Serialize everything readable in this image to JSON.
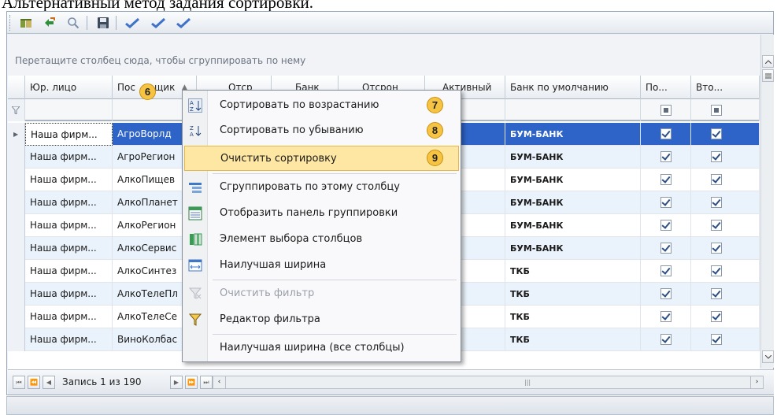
{
  "document": {
    "title": "Альтернативный метод задания сортировки."
  },
  "toolbar": {
    "icons": [
      "layout-icon",
      "refresh-icon",
      "search-icon",
      "save-icon",
      "check-icon",
      "check-all-icon",
      "check-selected-icon"
    ]
  },
  "group_panel": {
    "hint": "Перетащите столбец сюда, чтобы сгруппировать по нему"
  },
  "grid": {
    "columns": [
      "Юр. лицо",
      "Пос",
      "щик",
      "Отср",
      "Банк",
      "Отсрон",
      "Активный",
      "Банк по умолчанию",
      "По...",
      "Вто..."
    ],
    "rows": [
      {
        "legal": "Наша фирм...",
        "supplier": "АгроВорлд",
        "active": true,
        "bank": "БУМ-БАНК",
        "p1": true,
        "p2": true
      },
      {
        "legal": "Наша фирм...",
        "supplier": "АгроРегион",
        "active": true,
        "bank": "БУМ-БАНК",
        "p1": true,
        "p2": true
      },
      {
        "legal": "Наша фирм...",
        "supplier": "АлкоПищев",
        "active": true,
        "bank": "БУМ-БАНК",
        "p1": true,
        "p2": true
      },
      {
        "legal": "Наша фирм...",
        "supplier": "АлкоПланет",
        "active": false,
        "bank": "БУМ-БАНК",
        "p1": true,
        "p2": true
      },
      {
        "legal": "Наша фирм...",
        "supplier": "АлкоРегион",
        "active": true,
        "bank": "БУМ-БАНК",
        "p1": true,
        "p2": true
      },
      {
        "legal": "Наша фирм...",
        "supplier": "АлкоСервис",
        "active": true,
        "bank": "БУМ-БАНК",
        "p1": true,
        "p2": true
      },
      {
        "legal": "Наша фирм...",
        "supplier": "АлкоСинтез",
        "active": false,
        "bank": "ТКБ",
        "p1": true,
        "p2": true
      },
      {
        "legal": "Наша фирм...",
        "supplier": "АлкоТелеПл",
        "active": false,
        "bank": "ТКБ",
        "p1": true,
        "p2": true
      },
      {
        "legal": "Наша фирм...",
        "supplier": "АлкоТелеСе",
        "active": false,
        "bank": "ТКБ",
        "p1": true,
        "p2": true
      },
      {
        "legal": "Наша фирм...",
        "supplier": "ВиноКолбас",
        "active": false,
        "bank": "ТКБ",
        "p1": true,
        "p2": true
      }
    ]
  },
  "pager": {
    "record_text": "Запись 1 из 190"
  },
  "context_menu": {
    "items": [
      {
        "label": "Сортировать по возрастанию",
        "icon": "sort-ascending-icon",
        "badge": "7"
      },
      {
        "label": "Сортировать по убыванию",
        "icon": "sort-descending-icon",
        "badge": "8"
      },
      {
        "label": "Очистить сортировку",
        "icon": "clear-sort-icon",
        "badge": "9"
      },
      {
        "label": "Сгруппировать по этому столбцу",
        "icon": "group-by-icon"
      },
      {
        "label": "Отобразить панель группировки",
        "icon": "group-panel-icon"
      },
      {
        "label": "Элемент выбора столбцов",
        "icon": "column-chooser-icon"
      },
      {
        "label": "Наилучшая ширина",
        "icon": "best-fit-icon"
      },
      {
        "label": "Очистить фильтр",
        "icon": "clear-filter-icon"
      },
      {
        "label": "Редактор фильтра",
        "icon": "filter-editor-icon"
      },
      {
        "label": "Наилучшая ширина (все столбцы)",
        "icon": ""
      }
    ]
  },
  "header_badge": "6",
  "colors": {
    "selection": "#2e63c7",
    "alt_row": "#eaf3fb",
    "menu_highlight": "#fde7a2",
    "badge": "#f6c343"
  }
}
